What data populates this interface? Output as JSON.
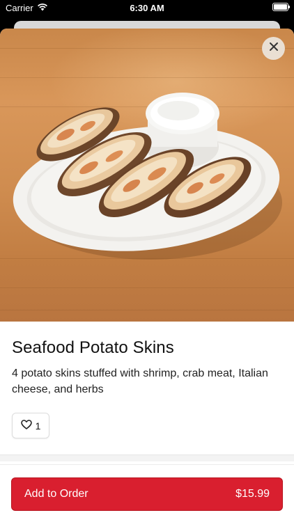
{
  "status_bar": {
    "carrier": "Carrier",
    "time": "6:30 AM"
  },
  "item": {
    "title": "Seafood Potato Skins",
    "description": "4 potato skins stuffed with shrimp, crab meat, Italian cheese, and herbs",
    "like_count": "1"
  },
  "order_bar": {
    "add_label": "Add to Order",
    "price": "$15.99"
  },
  "colors": {
    "accent": "#d91f2f",
    "close_button_bg": "#ece6de"
  },
  "icons": {
    "close": "close-icon",
    "heart": "heart-icon",
    "wifi": "wifi-icon",
    "battery": "battery-icon"
  }
}
